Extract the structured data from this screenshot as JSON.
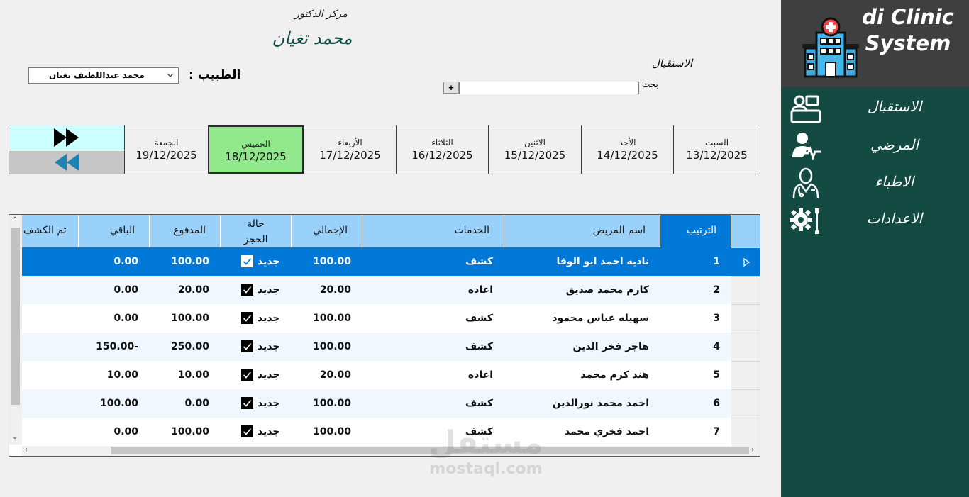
{
  "app": {
    "title_line1": "di Clinic",
    "title_line2": "System"
  },
  "sidebar": {
    "items": [
      {
        "label": "الاستقبال",
        "icon": "reception-desk-icon"
      },
      {
        "label": "المرضي",
        "icon": "patient-pulse-icon"
      },
      {
        "label": "الاطباء",
        "icon": "doctor-icon"
      },
      {
        "label": "الاعدادات",
        "icon": "settings-tools-icon"
      }
    ]
  },
  "header": {
    "center_label": "مركز الدكتور",
    "doctor_name": "محمد تغيان",
    "doctor_label": "الطبيب :",
    "doctor_selected": "محمد عبداللطيف تغيان",
    "reception_label": "الاستقبال",
    "search_label": "بحث",
    "search_value": "",
    "add_label": "+"
  },
  "days": [
    {
      "name": "الجمعة",
      "date": "19/12/2025",
      "active": false
    },
    {
      "name": "الخميس",
      "date": "18/12/2025",
      "active": true
    },
    {
      "name": "الأربعاء",
      "date": "17/12/2025",
      "active": false
    },
    {
      "name": "الثلاثاء",
      "date": "16/12/2025",
      "active": false
    },
    {
      "name": "الاثنين",
      "date": "15/12/2025",
      "active": false
    },
    {
      "name": "الأحد",
      "date": "14/12/2025",
      "active": false
    },
    {
      "name": "السبت",
      "date": "13/12/2025",
      "active": false
    }
  ],
  "table": {
    "columns": {
      "order": "الترتيب",
      "patient": "اسم المريض",
      "services": "الخدمات",
      "total": "الإجمالي",
      "status_line1": "حالة",
      "status_line2": "الحجز",
      "paid": "المدفوع",
      "remaining": "الباقي",
      "examined": "تم الكشف"
    },
    "rows": [
      {
        "order": "1",
        "patient": "ناديه احمد ابو الوفا",
        "service": "كشف",
        "total": "100.00",
        "status": "جديد",
        "checked": true,
        "paid": "100.00",
        "remaining": "0.00"
      },
      {
        "order": "2",
        "patient": "كارم محمد صديق",
        "service": "اعاده",
        "total": "20.00",
        "status": "جديد",
        "checked": true,
        "paid": "20.00",
        "remaining": "0.00"
      },
      {
        "order": "3",
        "patient": "سهيله عباس محمود",
        "service": "كشف",
        "total": "100.00",
        "status": "جديد",
        "checked": true,
        "paid": "100.00",
        "remaining": "0.00"
      },
      {
        "order": "4",
        "patient": "هاجر فخر الدين",
        "service": "كشف",
        "total": "100.00",
        "status": "جديد",
        "checked": true,
        "paid": "250.00",
        "remaining": "150.00-"
      },
      {
        "order": "5",
        "patient": "هند كرم محمد",
        "service": "اعاده",
        "total": "20.00",
        "status": "جديد",
        "checked": true,
        "paid": "10.00",
        "remaining": "10.00"
      },
      {
        "order": "6",
        "patient": "احمد محمد نورالدين",
        "service": "كشف",
        "total": "100.00",
        "status": "جديد",
        "checked": true,
        "paid": "0.00",
        "remaining": "100.00"
      },
      {
        "order": "7",
        "patient": "احمد فخري محمد",
        "service": "كشف",
        "total": "100.00",
        "status": "جديد",
        "checked": true,
        "paid": "100.00",
        "remaining": "0.00"
      }
    ]
  },
  "watermark": {
    "arabic": "مستقل",
    "latin": "mostaql.com"
  },
  "colors": {
    "sidebar": "#134b42",
    "brand_bg": "#3f3f3f",
    "header_cell": "#99d1fa",
    "selected": "#0078d7",
    "active_day": "#92e88c",
    "forward_button": "#ccffff"
  }
}
